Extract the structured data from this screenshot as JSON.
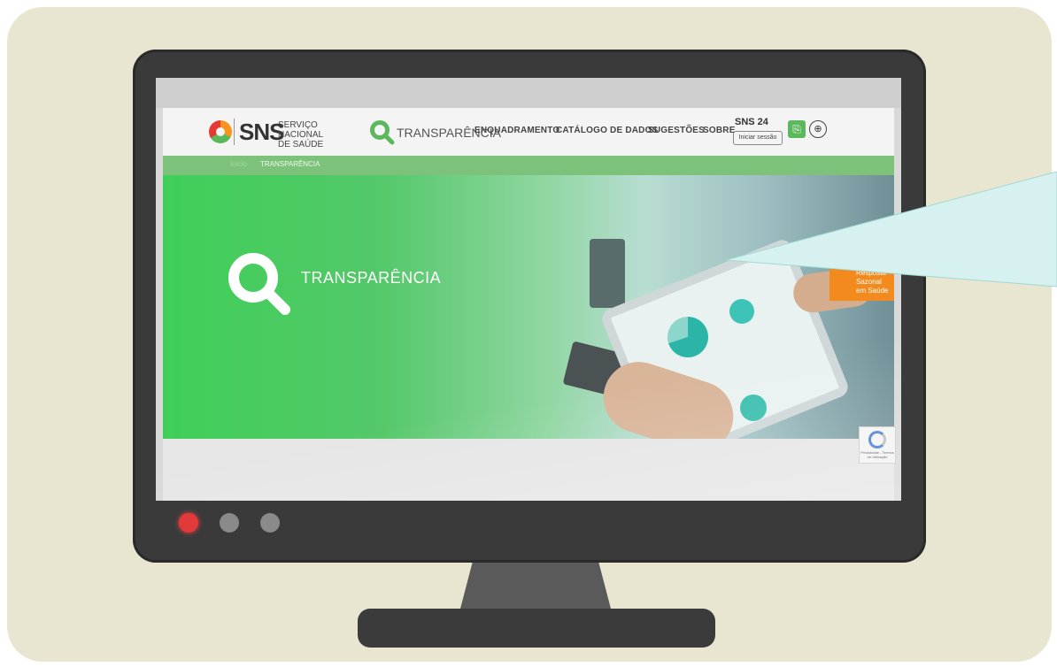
{
  "brand": {
    "acronym": "SNS",
    "subtitle_line1": "SERVIÇO NACIONAL",
    "subtitle_line2": "DE SAÚDE",
    "section": "TRANSPARÊNCIA"
  },
  "nav": {
    "items": [
      "ENQUADRAMENTO",
      "CATÁLOGO DE DADOS",
      "SUGESTÕES",
      "SOBRE"
    ]
  },
  "sns24": {
    "label": "SNS 24",
    "login": "Iniciar sessão"
  },
  "breadcrumb": {
    "home": "Início",
    "current": "TRANSPARÊNCIA"
  },
  "hero": {
    "title": "TRANSPARÊNCIA"
  },
  "badge": {
    "line1": "Resposta",
    "line2": "Sazonal",
    "line3": "em Saúde"
  },
  "recaptcha": {
    "text": "Privacidade - Termos de Utilização"
  },
  "colors": {
    "accent_green": "#5cb85c",
    "badge_orange": "#f28a1e",
    "monitor": "#3a3a3a",
    "callout": "#d6f1ef"
  },
  "icons": {
    "search": "magnifier-icon",
    "globe": "globe-icon",
    "accessibility": "accessibility-icon"
  }
}
